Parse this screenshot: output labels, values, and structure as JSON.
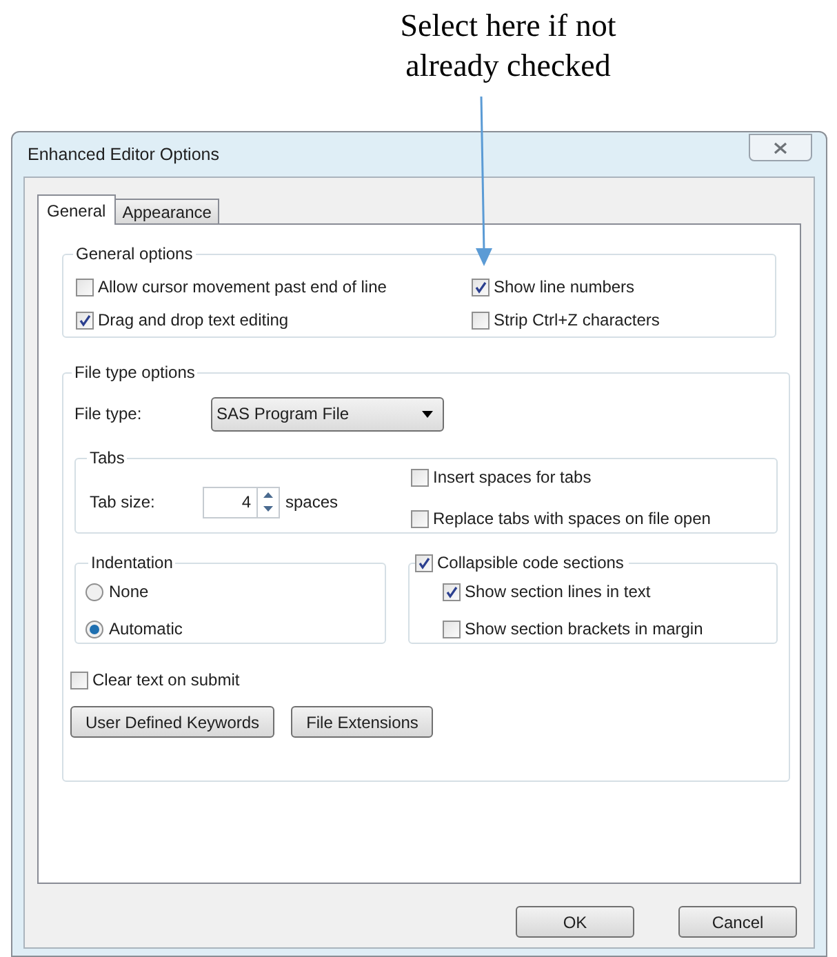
{
  "annotation": {
    "lines": [
      "Select here if not",
      "already checked"
    ]
  },
  "window": {
    "title": "Enhanced Editor Options"
  },
  "tabs": [
    {
      "label": "General",
      "selected": true
    },
    {
      "label": "Appearance",
      "selected": false
    }
  ],
  "general_options": {
    "title": "General options",
    "checkboxes": [
      {
        "label": "Allow cursor movement past end of line",
        "checked": false
      },
      {
        "label": "Show line numbers",
        "checked": true
      },
      {
        "label": "Drag and drop text editing",
        "checked": true
      },
      {
        "label": "Strip Ctrl+Z characters",
        "checked": false
      }
    ]
  },
  "file_type_options": {
    "title": "File type options",
    "file_type": {
      "label": "File type:",
      "value": "SAS Program File"
    },
    "tabs_group": {
      "title": "Tabs",
      "tab_size": {
        "label": "Tab size:",
        "value": "4",
        "unit": "spaces"
      },
      "checkboxes": [
        {
          "label": "Insert spaces for tabs",
          "checked": false
        },
        {
          "label": "Replace tabs with spaces on file open",
          "checked": false
        }
      ]
    },
    "indentation": {
      "title": "Indentation",
      "options": [
        {
          "label": "None",
          "selected": false
        },
        {
          "label": "Automatic",
          "selected": true
        }
      ]
    },
    "collapsible": {
      "label": "Collapsible code sections",
      "checked": true,
      "children": [
        {
          "label": "Show section lines in text",
          "checked": true
        },
        {
          "label": "Show section brackets in margin",
          "checked": false
        }
      ]
    },
    "clear_text": {
      "label": "Clear text on submit",
      "checked": false
    },
    "buttons": [
      "User Defined Keywords",
      "File Extensions"
    ]
  },
  "dialog_buttons": [
    "OK",
    "Cancel"
  ]
}
